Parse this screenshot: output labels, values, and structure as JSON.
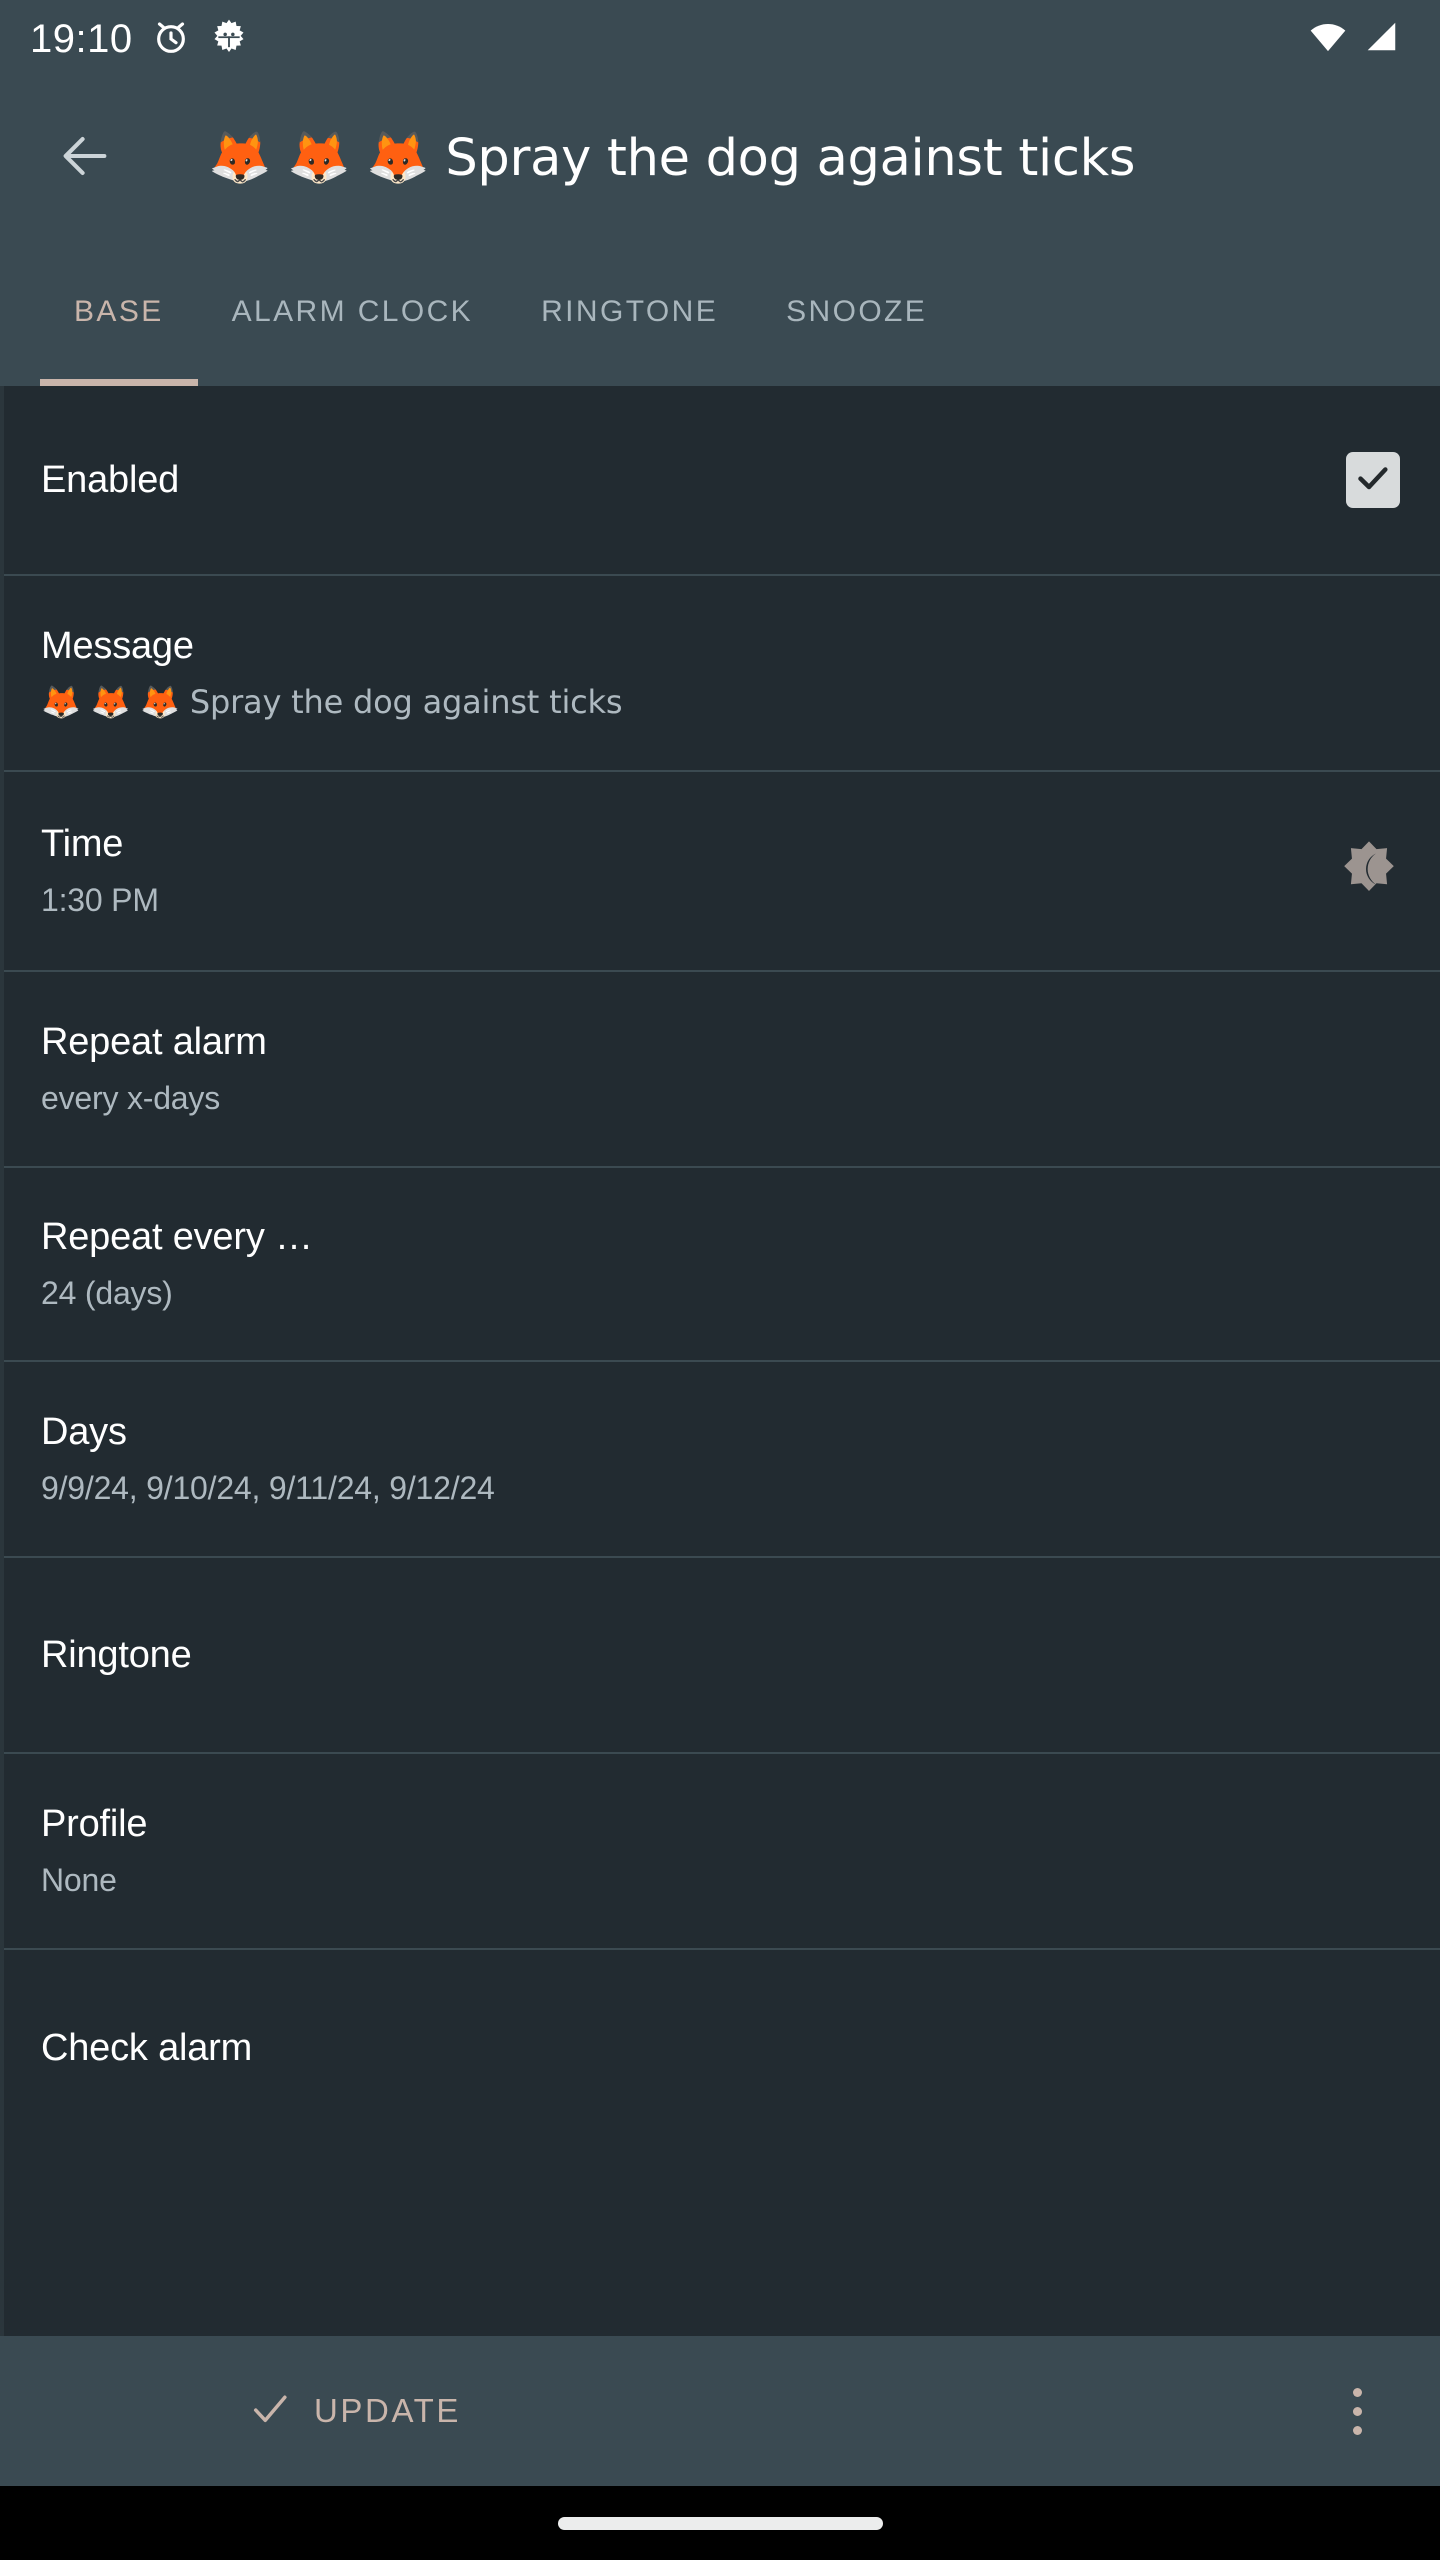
{
  "status_bar": {
    "time": "19:10",
    "icons_left": [
      "alarm-clock-icon",
      "android-debug-gear-icon"
    ],
    "icons_right": [
      "wifi-icon",
      "cell-signal-icon"
    ]
  },
  "app_bar": {
    "back_icon": "back-arrow-icon",
    "title": "🦊 🦊 🦊 Spray the dog against ticks"
  },
  "tabs": [
    {
      "label": "BASE",
      "active": true
    },
    {
      "label": "ALARM CLOCK",
      "active": false
    },
    {
      "label": "RINGTONE",
      "active": false
    },
    {
      "label": "SNOOZE",
      "active": false
    }
  ],
  "rows": {
    "enabled": {
      "title": "Enabled",
      "checked": true
    },
    "message": {
      "title": "Message",
      "value": "🦊 🦊 🦊 Spray the dog against ticks"
    },
    "time": {
      "title": "Time",
      "value": "1:30 PM",
      "icon": "night-brightness-icon"
    },
    "repeat_alarm": {
      "title": "Repeat alarm",
      "value": "every x-days"
    },
    "repeat_every": {
      "title": "Repeat every …",
      "value": "24 (days)"
    },
    "days": {
      "title": "Days",
      "value": "9/9/24, 9/10/24, 9/11/24, 9/12/24"
    },
    "ringtone": {
      "title": "Ringtone",
      "value": ""
    },
    "profile": {
      "title": "Profile",
      "value": "None"
    },
    "check_alarm": {
      "title": "Check alarm",
      "value": ""
    }
  },
  "bottom_bar": {
    "update_label": "UPDATE",
    "update_icon": "check-icon",
    "overflow_icon": "more-vertical-icon"
  },
  "colors": {
    "chrome": "#3a4a52",
    "content_bg": "#222b31",
    "accent": "#c9b5ab",
    "divider": "#3b4a51",
    "primary_text": "#ffffff",
    "secondary_text": "#aeb9c0",
    "checkbox_fill": "#d8dbdc"
  }
}
